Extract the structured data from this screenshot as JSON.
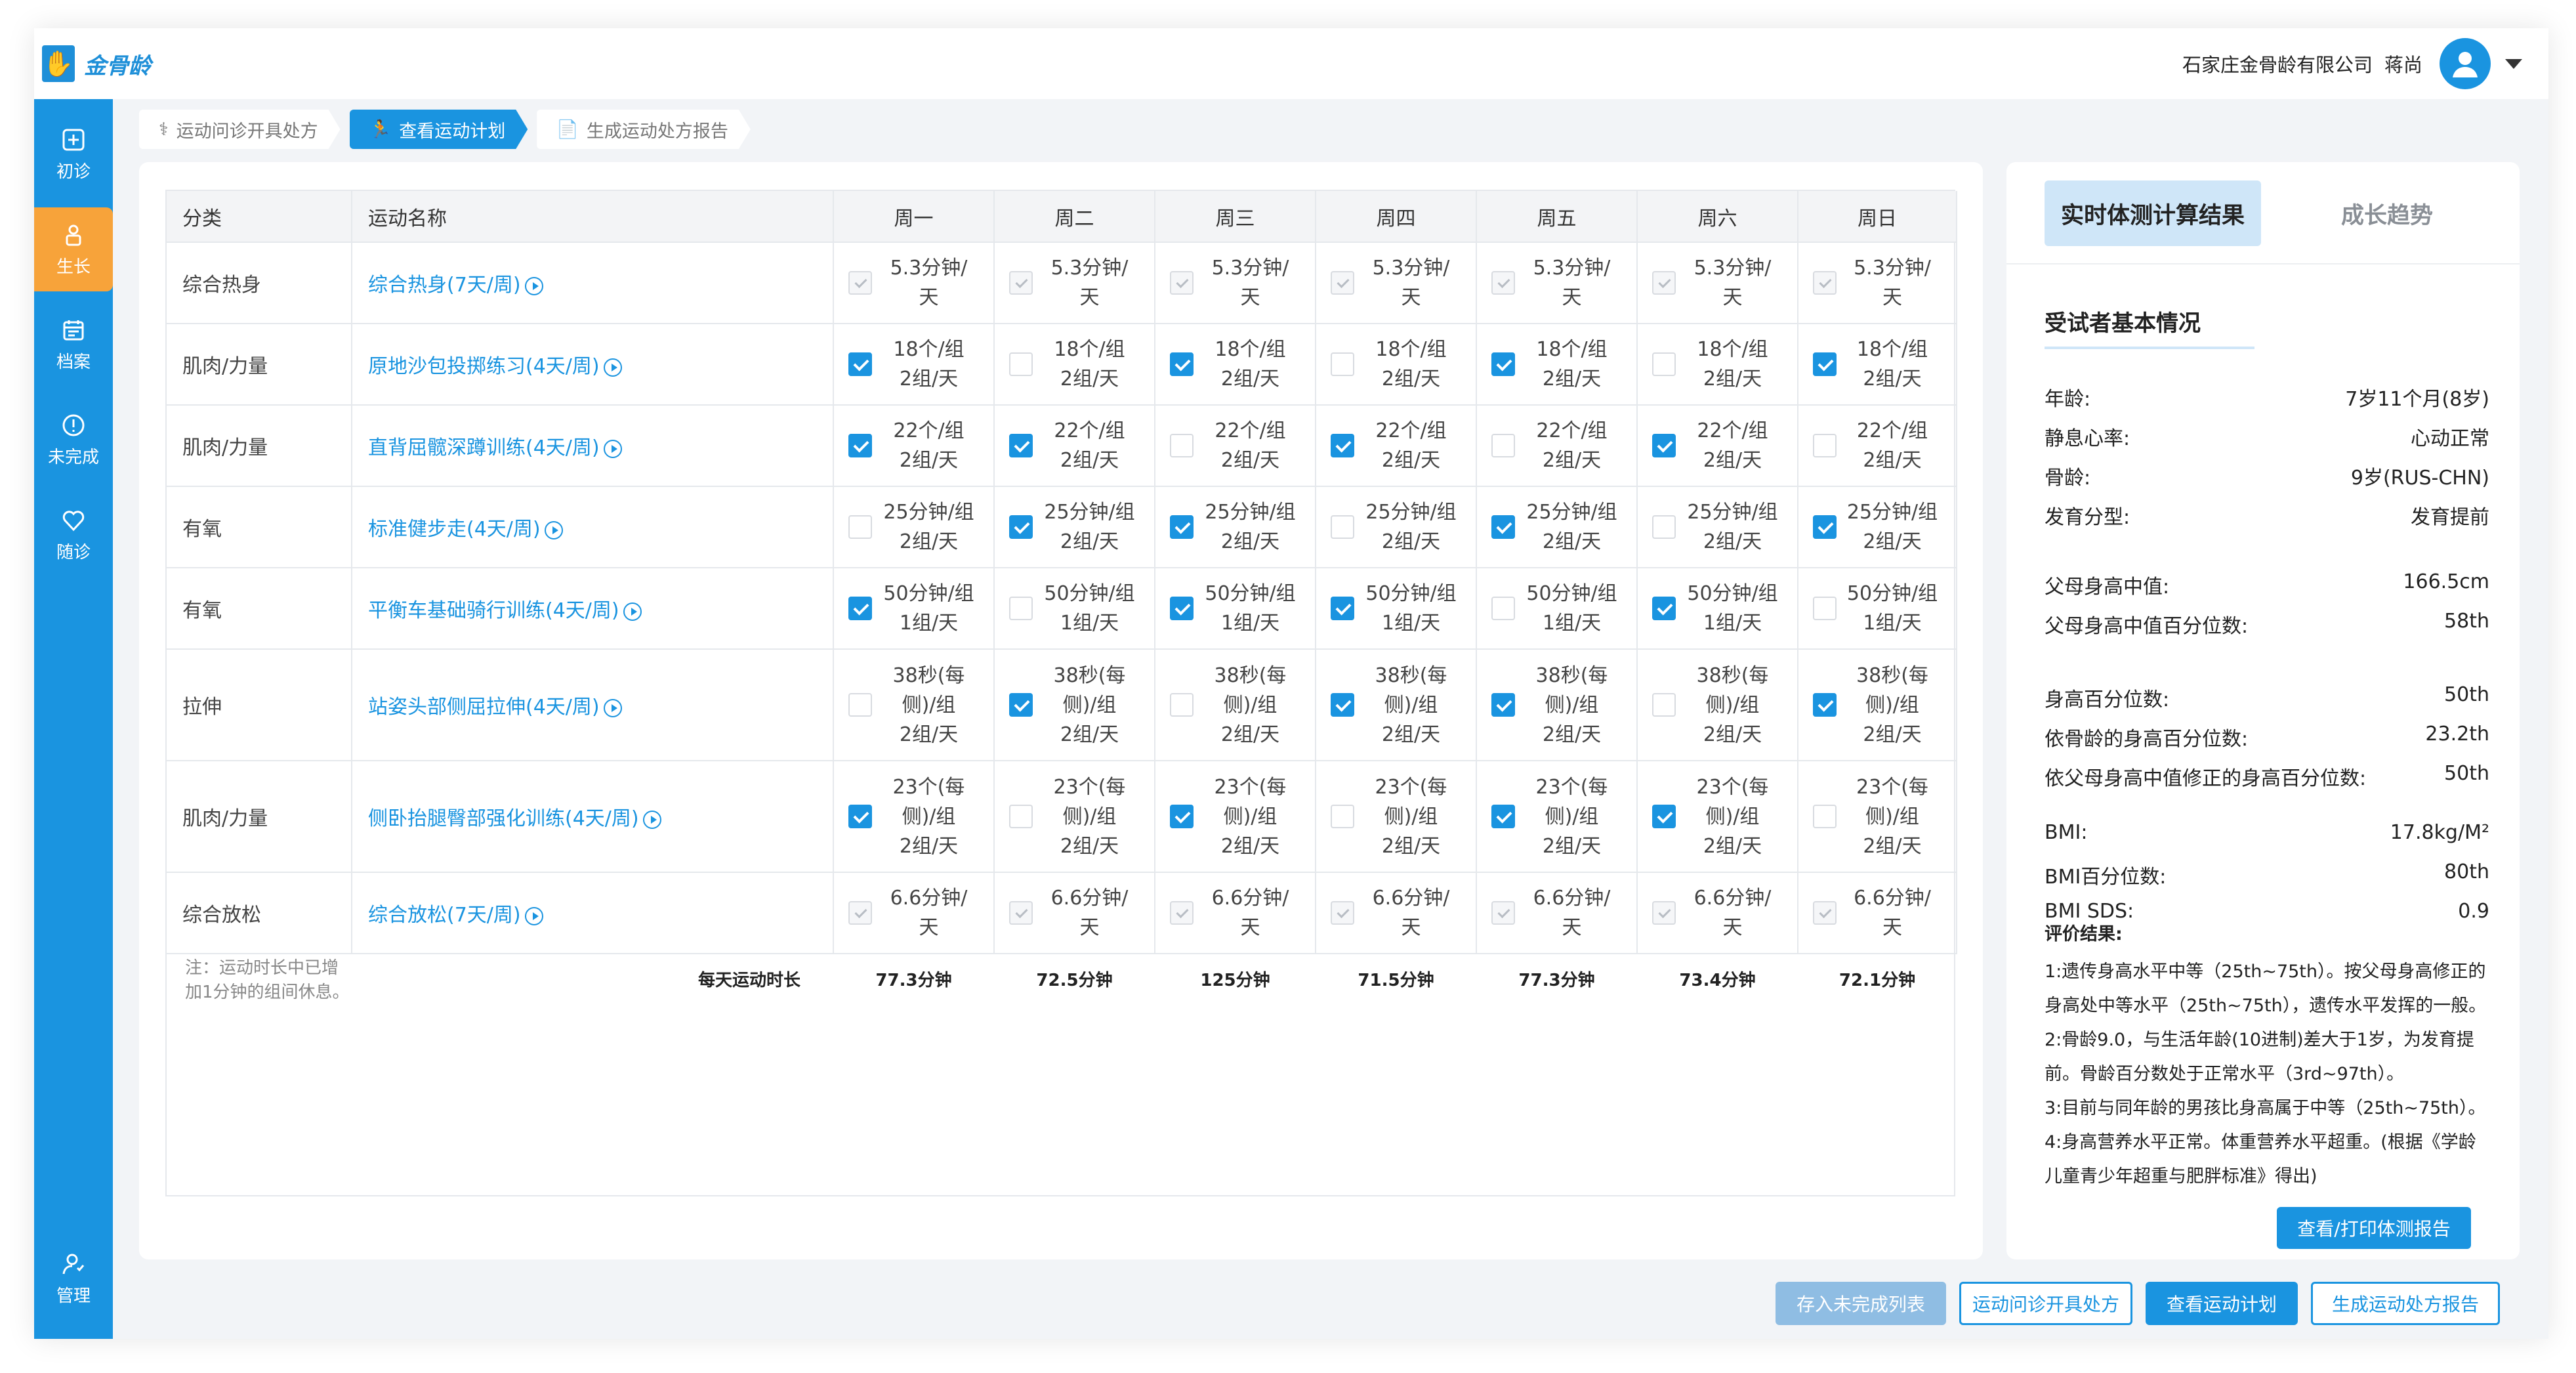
{
  "app": {
    "logo_text": "金骨龄",
    "company": "石家庄金骨龄有限公司",
    "user": "蒋尚"
  },
  "sidebar": [
    {
      "label": "初诊",
      "icon": "plus-square-icon"
    },
    {
      "label": "生长",
      "icon": "child-icon"
    },
    {
      "label": "档案",
      "icon": "calendar-icon"
    },
    {
      "label": "未完成",
      "icon": "alert-circle-icon"
    },
    {
      "label": "随诊",
      "icon": "heart-icon"
    },
    {
      "label": "管理",
      "icon": "user-manage-icon"
    }
  ],
  "steps": [
    {
      "label": "运动问诊开具处方",
      "icon": "stethoscope-icon"
    },
    {
      "label": "查看运动计划",
      "icon": "runner-icon"
    },
    {
      "label": "生成运动处方报告",
      "icon": "document-icon"
    }
  ],
  "table": {
    "headers": [
      "分类",
      "运动名称",
      "周一",
      "周二",
      "周三",
      "周四",
      "周五",
      "周六",
      "周日"
    ],
    "rows": [
      {
        "category": "综合热身",
        "name": "综合热身(7天/周)",
        "text": "5.3分钟/\n天",
        "checks": [
          "d",
          "d",
          "d",
          "d",
          "d",
          "d",
          "d"
        ]
      },
      {
        "category": "肌肉/力量",
        "name": "原地沙包投掷练习(4天/周)",
        "text": "18个/组\n2组/天",
        "checks": [
          "1",
          "0",
          "1",
          "0",
          "1",
          "0",
          "1"
        ]
      },
      {
        "category": "肌肉/力量",
        "name": "直背屈髋深蹲训练(4天/周)",
        "text": "22个/组\n2组/天",
        "checks": [
          "1",
          "1",
          "0",
          "1",
          "0",
          "1",
          "0"
        ]
      },
      {
        "category": "有氧",
        "name": "标准健步走(4天/周)",
        "text": "25分钟/组\n2组/天",
        "checks": [
          "0",
          "1",
          "1",
          "0",
          "1",
          "0",
          "1"
        ]
      },
      {
        "category": "有氧",
        "name": "平衡车基础骑行训练(4天/周)",
        "text": "50分钟/组\n1组/天",
        "checks": [
          "1",
          "0",
          "1",
          "1",
          "0",
          "1",
          "0"
        ]
      },
      {
        "category": "拉伸",
        "name": "站姿头部侧屈拉伸(4天/周)",
        "text": "38秒(每\n侧)/组\n2组/天",
        "checks": [
          "0",
          "1",
          "0",
          "1",
          "1",
          "0",
          "1"
        ]
      },
      {
        "category": "肌肉/力量",
        "name": "侧卧抬腿臀部强化训练(4天/周)",
        "text": "23个(每\n侧)/组\n2组/天",
        "checks": [
          "1",
          "0",
          "1",
          "0",
          "1",
          "1",
          "0"
        ]
      },
      {
        "category": "综合放松",
        "name": "综合放松(7天/周)",
        "text": "6.6分钟/\n天",
        "checks": [
          "d",
          "d",
          "d",
          "d",
          "d",
          "d",
          "d"
        ]
      }
    ],
    "note": "注：运动时长中已增加1分钟的组间休息。",
    "daily_label": "每天运动时长",
    "daily_totals": [
      "77.3分钟",
      "72.5分钟",
      "125分钟",
      "71.5分钟",
      "77.3分钟",
      "73.4分钟",
      "72.1分钟"
    ]
  },
  "right": {
    "tab_active": "实时体测计算结果",
    "tab_other": "成长趋势",
    "section_title": "受试者基本情况",
    "basic": [
      {
        "k": "年龄:",
        "v": "7岁11个月(8岁)"
      },
      {
        "k": "静息心率:",
        "v": "心动正常"
      },
      {
        "k": "骨龄:",
        "v": "9岁(RUS-CHN)"
      },
      {
        "k": "发育分型:",
        "v": "发育提前"
      }
    ],
    "parents": [
      {
        "k": "父母身高中值:",
        "v": "166.5cm"
      },
      {
        "k": "父母身高中值百分位数:",
        "v": "58th"
      }
    ],
    "percentiles": [
      {
        "k": "身高百分位数:",
        "v": "50th"
      },
      {
        "k": "依骨龄的身高百分位数:",
        "v": "23.2th"
      },
      {
        "k": "依父母身高中值修正的身高百分位数:",
        "v": "50th"
      }
    ],
    "bmi": [
      {
        "k": "BMI:",
        "v": "17.8kg/M²"
      },
      {
        "k": "BMI百分位数:",
        "v": "80th"
      },
      {
        "k": "BMI SDS:",
        "v": "0.9"
      }
    ],
    "eval_title": "评价结果:",
    "eval_lines": [
      "1:遗传身高水平中等（25th~75th）。按父母身高修正的",
      "身高处中等水平（25th~75th），遗传水平发挥的一般。",
      "2:骨龄9.0，与生活年龄(10进制)差大于1岁，为发育提",
      "前。骨龄百分数处于正常水平（3rd~97th）。",
      "3:目前与同年龄的男孩比身高属于中等（25th~75th）。",
      "4:身高营养水平正常。体重营养水平超重。(根据《学龄",
      "儿童青少年超重与肥胖标准》得出)"
    ],
    "print_button": "查看/打印体测报告"
  },
  "bottom_buttons": [
    "存入未完成列表",
    "运动问诊开具处方",
    "查看运动计划",
    "生成运动处方报告"
  ]
}
